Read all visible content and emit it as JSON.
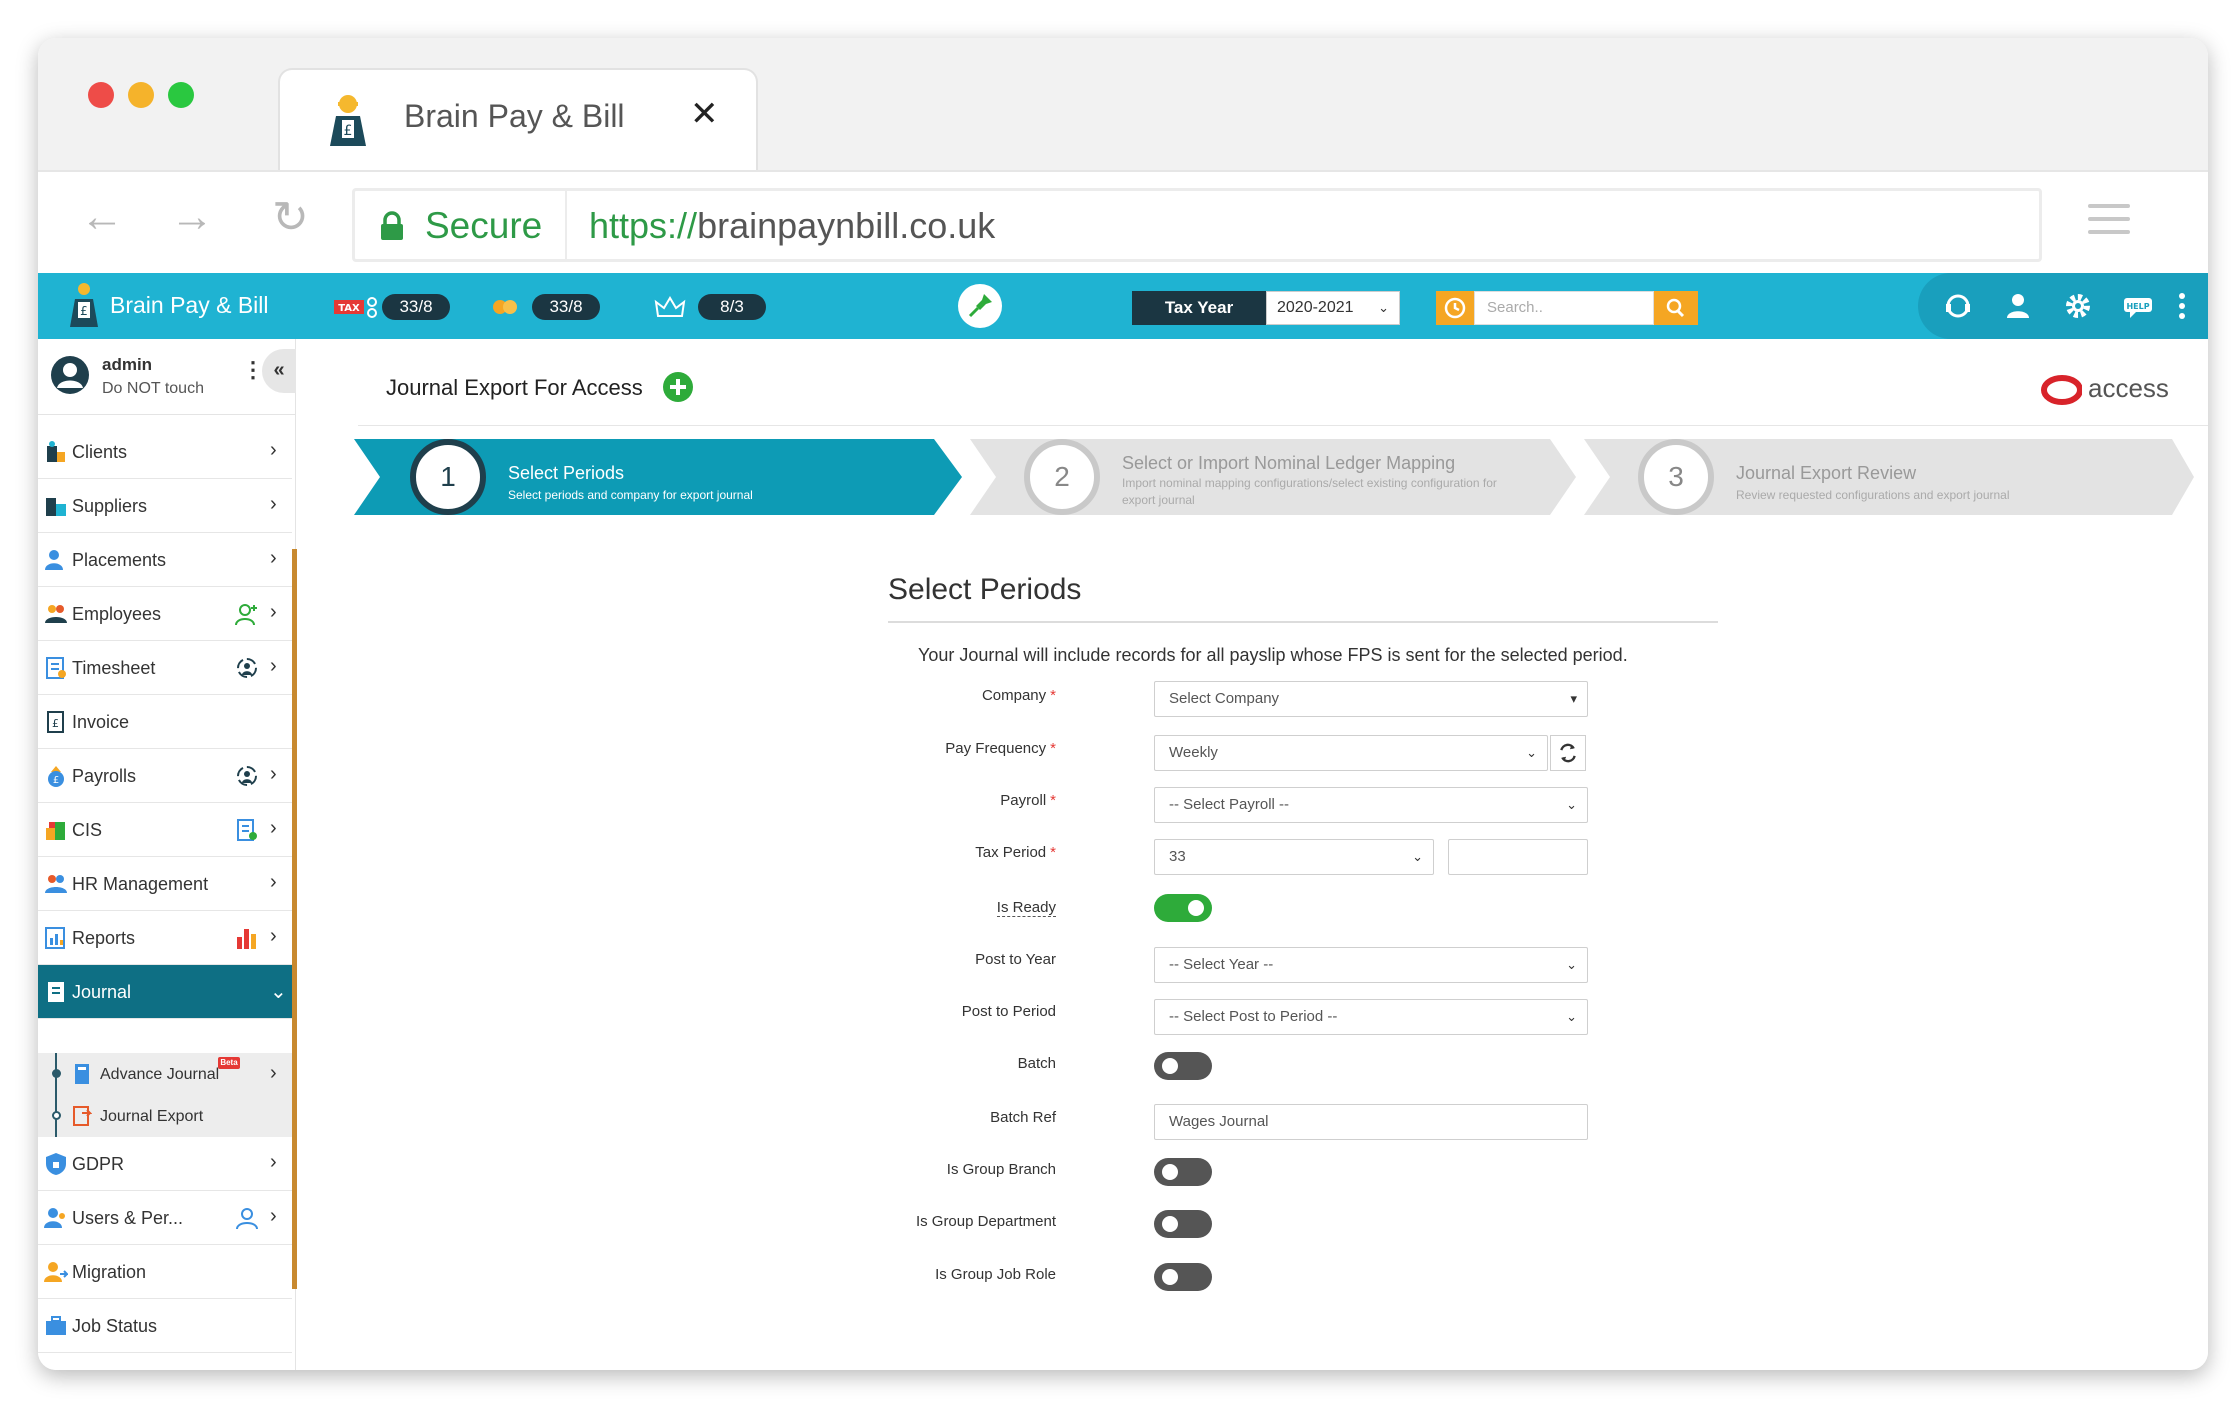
{
  "browser": {
    "tab_title": "Brain Pay & Bill",
    "tab_close": "✕",
    "secure_label": "Secure",
    "url_scheme": "https://",
    "url_host": "brainpaynbill.co.uk",
    "back": "←",
    "forward": "→",
    "reload": "↻"
  },
  "topbar": {
    "app_name": "Brain Pay & Bill",
    "stats": [
      {
        "icon": "tax-icon",
        "value": "33/8"
      },
      {
        "icon": "coins-icon",
        "value": "33/8"
      },
      {
        "icon": "crown-icon",
        "value": "8/3"
      }
    ],
    "tax_year_label": "Tax Year",
    "tax_year_value": "2020-2021",
    "search_placeholder": "Search..",
    "accent": "#1fb3d2",
    "dark": "#1b3642",
    "orange": "#f5a623"
  },
  "user": {
    "name": "admin",
    "subtitle": "Do NOT touch",
    "collapse": "«",
    "kebab": "⋮"
  },
  "sidebar": {
    "items": [
      {
        "label": "Clients",
        "chevron": "›"
      },
      {
        "label": "Suppliers",
        "chevron": "›"
      },
      {
        "label": "Placements",
        "chevron": "›"
      },
      {
        "label": "Employees",
        "chevron": "›"
      },
      {
        "label": "Timesheet",
        "chevron": "›"
      },
      {
        "label": "Invoice",
        "chevron": ""
      },
      {
        "label": "Payrolls",
        "chevron": "›"
      },
      {
        "label": "CIS",
        "chevron": "›"
      },
      {
        "label": "HR Management",
        "chevron": "›"
      },
      {
        "label": "Reports",
        "chevron": "›"
      },
      {
        "label": "Journal",
        "chevron": "⌄"
      },
      {
        "label": "GDPR",
        "chevron": "›"
      },
      {
        "label": "Users & Per...",
        "chevron": "›"
      },
      {
        "label": "Migration",
        "chevron": ""
      },
      {
        "label": "Job Status",
        "chevron": ""
      }
    ],
    "journal_sub": [
      {
        "label": "Advance Journal",
        "badge": "Beta",
        "chevron": "›"
      },
      {
        "label": "Journal Export"
      }
    ]
  },
  "page": {
    "title": "Journal Export For Access",
    "brand": "access"
  },
  "steps": [
    {
      "num": "1",
      "title": "Select Periods",
      "sub": "Select periods and company for export journal"
    },
    {
      "num": "2",
      "title": "Select or Import Nominal Ledger Mapping",
      "sub": "Import nominal mapping configurations/select existing configuration for export journal"
    },
    {
      "num": "3",
      "title": "Journal Export Review",
      "sub": "Review requested configurations and export journal"
    }
  ],
  "form": {
    "section_title": "Select Periods",
    "intro": "Your Journal will include records for all payslip whose FPS is sent for the selected period.",
    "required_mark": "*",
    "company_label": "Company",
    "company_value": "Select Company",
    "pay_frequency_label": "Pay Frequency",
    "pay_frequency_value": "Weekly",
    "payroll_label": "Payroll",
    "payroll_value": "-- Select Payroll --",
    "tax_period_label": "Tax Period",
    "tax_period_value": "33",
    "tax_period_extra": "",
    "is_ready_label": "Is Ready",
    "is_ready": true,
    "post_to_year_label": "Post to Year",
    "post_to_year_value": "-- Select Year --",
    "post_to_period_label": "Post to Period",
    "post_to_period_value": "-- Select Post to Period --",
    "batch_label": "Batch",
    "batch": false,
    "batch_ref_label": "Batch Ref",
    "batch_ref_value": "Wages Journal",
    "group_branch_label": "Is Group Branch",
    "group_branch": false,
    "group_department_label": "Is Group Department",
    "group_department": false,
    "group_job_role_label": "Is Group Job Role",
    "group_job_role": false
  }
}
